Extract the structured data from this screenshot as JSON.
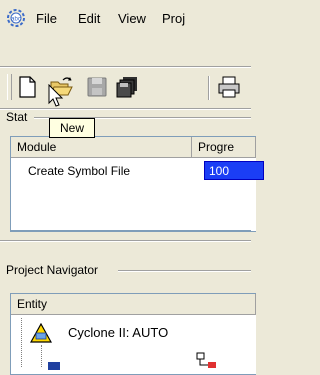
{
  "menu": {
    "items": [
      {
        "label": "File"
      },
      {
        "label": "Edit"
      },
      {
        "label": "View"
      },
      {
        "label": "Proj"
      }
    ]
  },
  "toolbar": {
    "buttons": [
      "new-file-icon",
      "open-folder-icon",
      "save-icon",
      "save-all-icon",
      "print-icon"
    ]
  },
  "tooltip": {
    "text": "New"
  },
  "status_panel": {
    "title": "Stat",
    "columns": [
      "Module",
      "Progre"
    ],
    "rows": [
      {
        "module": "Create Symbol File",
        "progress_text": "100"
      }
    ]
  },
  "project_navigator": {
    "title": "Project Navigator",
    "column": "Entity",
    "device_label": "Cyclone II: AUTO"
  }
}
